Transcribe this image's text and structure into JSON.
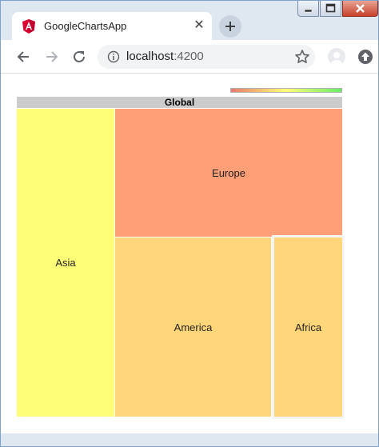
{
  "window": {
    "tab_title": "GoogleChartsApp",
    "tab_close": "✕",
    "favicon": "angular-shield-icon",
    "controls": [
      "minimize-icon",
      "maximize-icon",
      "close-icon"
    ]
  },
  "toolbar": {
    "back_icon": "arrow-left-icon",
    "forward_icon": "arrow-right-icon",
    "reload_icon": "reload-icon",
    "url_host": "localhost",
    "url_port": ":4200",
    "bookmark_icon": "star-icon",
    "profile_icon": "avatar-icon",
    "extension_icon": "upload-circle-icon"
  },
  "chart_data": {
    "type": "treemap",
    "root": "Global",
    "color_scale": [
      "#e77b6b",
      "#ffff77",
      "#66ee66"
    ],
    "nodes": [
      {
        "label": "Asia",
        "color": "#ffff77"
      },
      {
        "label": "Europe",
        "color": "#ff9f77"
      },
      {
        "label": "America",
        "color": "#ffd77a"
      },
      {
        "label": "Africa",
        "color": "#ffd77a"
      }
    ]
  }
}
